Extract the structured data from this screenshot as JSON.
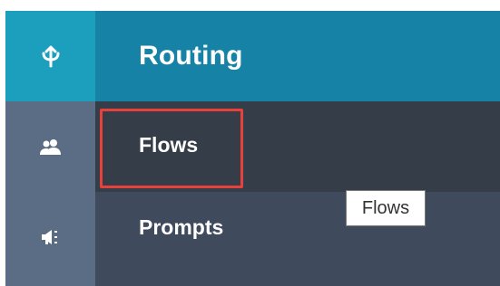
{
  "rail": {
    "items": [
      {
        "icon": "routing-icon",
        "active": true
      },
      {
        "icon": "users-icon",
        "active": false
      },
      {
        "icon": "megaphone-icon",
        "active": false
      }
    ]
  },
  "panel": {
    "title": "Routing",
    "items": [
      {
        "label": "Flows",
        "selected": true,
        "highlighted": true
      },
      {
        "label": "Prompts",
        "selected": false
      }
    ]
  },
  "tooltip": {
    "text": "Flows"
  },
  "colors": {
    "rail_bg": "#5b6d84",
    "rail_active": "#1b9fbd",
    "header_bg": "#1582a6",
    "panel_bg": "#3f4a5c",
    "selected_bg": "#353d48",
    "highlight_border": "#e8403b"
  }
}
